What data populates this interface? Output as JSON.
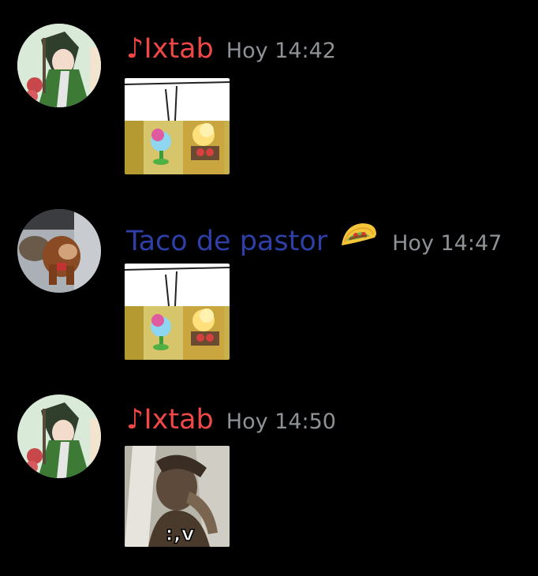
{
  "messages": [
    {
      "author": "♪Ixtab",
      "author_color": "#f04747",
      "timestamp": "Hoy 14:42",
      "avatar_icon": "anime-character-avatar",
      "attachment_icon": "plants-vs-zombies-meme-image"
    },
    {
      "author": "Taco de pastor",
      "author_color": "#2e3fa8",
      "emoji": "taco-emoji",
      "timestamp": "Hoy 14:47",
      "avatar_icon": "donkey-kong-avatar",
      "attachment_icon": "plants-vs-zombies-meme-image"
    },
    {
      "author": "♪Ixtab",
      "author_color": "#f04747",
      "timestamp": "Hoy 14:50",
      "avatar_icon": "anime-character-avatar",
      "attachment_icon": "man-meme-image",
      "attachment_caption": ":,v"
    }
  ]
}
